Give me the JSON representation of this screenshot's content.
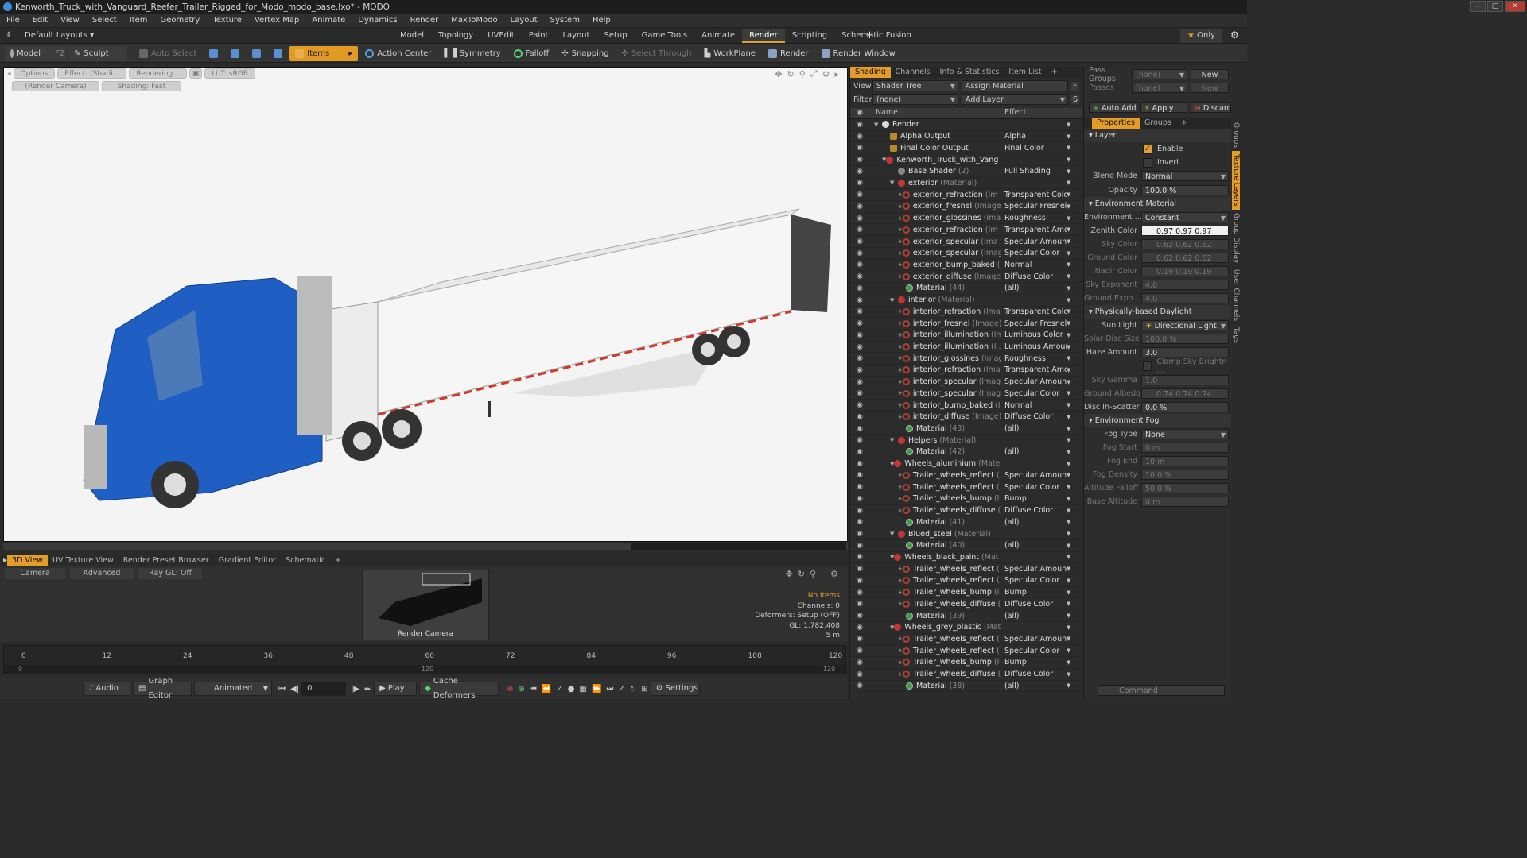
{
  "window": {
    "title": "Kenworth_Truck_with_Vanguard_Reefer_Trailer_Rigged_for_Modo_modo_base.lxo* - MODO"
  },
  "menu": [
    "File",
    "Edit",
    "View",
    "Select",
    "Item",
    "Geometry",
    "Texture",
    "Vertex Map",
    "Animate",
    "Dynamics",
    "Render",
    "MaxToModo",
    "Layout",
    "System",
    "Help"
  ],
  "layouts": {
    "selector": "Default Layouts",
    "tabs": [
      "Model",
      "Topology",
      "UVEdit",
      "Paint",
      "Layout",
      "Setup",
      "Game Tools",
      "Animate",
      "Render",
      "Scripting",
      "Schematic Fusion"
    ],
    "active": "Render",
    "only": "Only"
  },
  "toolbar": {
    "model": "Model",
    "model_key": "F2",
    "sculpt": "Sculpt",
    "auto_select": "Auto Select",
    "items": "Items",
    "action_center": "Action Center",
    "symmetry": "Symmetry",
    "falloff": "Falloff",
    "snapping": "Snapping",
    "select_through": "Select Through",
    "workplane": "WorkPlane",
    "render": "Render",
    "render_window": "Render Window"
  },
  "viewport": {
    "options": "Options",
    "effect": "Effect: (Shadi...",
    "rendering": "Rendering...",
    "lut": "LUT: sRGB",
    "camera": "(Render Camera)",
    "shading": "Shading: Fast",
    "colors": {
      "cab": "#1f5fc4",
      "trailer": "#f2f2f2",
      "rail": "#d03a2a"
    }
  },
  "bottom": {
    "tabs": [
      "3D View",
      "UV Texture View",
      "Render Preset Browser",
      "Gradient Editor",
      "Schematic"
    ],
    "active": "3D View",
    "camera": "Camera",
    "advanced": "Advanced",
    "raygl": "Ray GL: Off",
    "cam_label": "Render Camera",
    "stats": {
      "items": "No Items",
      "channels": "Channels: 0",
      "deformers": "Deformers: Setup (OFF)",
      "gl": "GL: 1,782,408",
      "dist": "5 m"
    }
  },
  "timeline": {
    "ticks": [
      "0",
      "12",
      "24",
      "36",
      "48",
      "60",
      "72",
      "84",
      "96",
      "108",
      "120"
    ],
    "subticks": [
      "0",
      "120",
      "120"
    ]
  },
  "transport": {
    "audio": "Audio",
    "graph_editor": "Graph Editor",
    "animated": "Animated",
    "frame": "0",
    "play": "Play",
    "cache": "Cache Deformers",
    "settings": "Settings"
  },
  "shading": {
    "tabs": [
      "Shading",
      "Channels",
      "Info & Statistics",
      "Item List"
    ],
    "active": "Shading",
    "view_label": "View",
    "view_value": "Shader Tree",
    "assign": "Assign Material",
    "filter_label": "Filter",
    "filter_value": "(none)",
    "add_layer": "Add Layer",
    "col_name": "Name",
    "col_effect": "Effect",
    "rows": [
      {
        "indent": 0,
        "exp": "▼",
        "icon": "ball",
        "name": "Render",
        "sub": "",
        "effect": ""
      },
      {
        "indent": 1,
        "exp": "",
        "icon": "out",
        "name": "Alpha Output",
        "sub": "",
        "effect": "Alpha"
      },
      {
        "indent": 1,
        "exp": "",
        "icon": "out",
        "name": "Final Color Output",
        "sub": "",
        "effect": "Final Color"
      },
      {
        "indent": 1,
        "exp": "▼",
        "icon": "mat",
        "name": "Kenworth_Truck_with_Vang ...",
        "sub": "",
        "effect": ""
      },
      {
        "indent": 2,
        "exp": "",
        "icon": "shd",
        "name": "Base Shader",
        "sub": "(2)",
        "effect": "Full Shading"
      },
      {
        "indent": 2,
        "exp": "▼",
        "icon": "mat",
        "name": "exterior",
        "sub": "(Material)",
        "effect": ""
      },
      {
        "indent": 3,
        "exp": "+",
        "icon": "img",
        "name": "exterior_refraction",
        "sub": "(Im ...",
        "effect": "Transparent Color"
      },
      {
        "indent": 3,
        "exp": "+",
        "icon": "img",
        "name": "exterior_fresnel",
        "sub": "(Image)",
        "effect": "Specular Fresnel"
      },
      {
        "indent": 3,
        "exp": "+",
        "icon": "img",
        "name": "exterior_glossines",
        "sub": "(Ima ...",
        "effect": "Roughness"
      },
      {
        "indent": 3,
        "exp": "+",
        "icon": "img",
        "name": "exterior_refraction",
        "sub": "(Im ...",
        "effect": "Transparent Amo ..."
      },
      {
        "indent": 3,
        "exp": "+",
        "icon": "img",
        "name": "exterior_specular",
        "sub": "(Ima ...",
        "effect": "Specular Amount"
      },
      {
        "indent": 3,
        "exp": "+",
        "icon": "img",
        "name": "exterior_specular",
        "sub": "(Image)",
        "effect": "Specular Color"
      },
      {
        "indent": 3,
        "exp": "+",
        "icon": "img",
        "name": "exterior_bump_baked",
        "sub": "(I ...",
        "effect": "Normal"
      },
      {
        "indent": 3,
        "exp": "+",
        "icon": "img",
        "name": "exterior_diffuse",
        "sub": "(Image)",
        "effect": "Diffuse Color"
      },
      {
        "indent": 3,
        "exp": "",
        "icon": "mt",
        "name": "Material",
        "sub": "(44)",
        "effect": "(all)"
      },
      {
        "indent": 2,
        "exp": "▼",
        "icon": "mat",
        "name": "interior",
        "sub": "(Material)",
        "effect": ""
      },
      {
        "indent": 3,
        "exp": "+",
        "icon": "img",
        "name": "interior_refraction",
        "sub": "(Ima ...",
        "effect": "Transparent Color"
      },
      {
        "indent": 3,
        "exp": "+",
        "icon": "img",
        "name": "interior_fresnel",
        "sub": "(Image)",
        "effect": "Specular Fresnel"
      },
      {
        "indent": 3,
        "exp": "+",
        "icon": "img",
        "name": "interior_illumination",
        "sub": "(Im ...",
        "effect": "Luminous Color"
      },
      {
        "indent": 3,
        "exp": "+",
        "icon": "img",
        "name": "interior_illumination",
        "sub": "(I ...",
        "effect": "Luminous Amount"
      },
      {
        "indent": 3,
        "exp": "+",
        "icon": "img",
        "name": "interior_glossines",
        "sub": "(Image)",
        "effect": "Roughness"
      },
      {
        "indent": 3,
        "exp": "+",
        "icon": "img",
        "name": "interior_refraction",
        "sub": "(Ima ...",
        "effect": "Transparent Amo ..."
      },
      {
        "indent": 3,
        "exp": "+",
        "icon": "img",
        "name": "interior_specular",
        "sub": "(Imag ...",
        "effect": "Specular Amount"
      },
      {
        "indent": 3,
        "exp": "+",
        "icon": "img",
        "name": "interior_specular",
        "sub": "(Image)",
        "effect": "Specular Color"
      },
      {
        "indent": 3,
        "exp": "+",
        "icon": "img",
        "name": "interior_bump_baked",
        "sub": "(I ...",
        "effect": "Normal"
      },
      {
        "indent": 3,
        "exp": "+",
        "icon": "img",
        "name": "interior_diffuse",
        "sub": "(Image)",
        "effect": "Diffuse Color"
      },
      {
        "indent": 3,
        "exp": "",
        "icon": "mt",
        "name": "Material",
        "sub": "(43)",
        "effect": "(all)"
      },
      {
        "indent": 2,
        "exp": "▼",
        "icon": "mat",
        "name": "Helpers",
        "sub": "(Material)",
        "effect": ""
      },
      {
        "indent": 3,
        "exp": "",
        "icon": "mt",
        "name": "Material",
        "sub": "(42)",
        "effect": "(all)"
      },
      {
        "indent": 2,
        "exp": "▼",
        "icon": "mat",
        "name": "Wheels_aluminium",
        "sub": "(Material)",
        "effect": ""
      },
      {
        "indent": 3,
        "exp": "+",
        "icon": "img",
        "name": "Trailer_wheels_reflect",
        "sub": "( ...",
        "effect": "Specular Amount"
      },
      {
        "indent": 3,
        "exp": "+",
        "icon": "img",
        "name": "Trailer_wheels_reflect",
        "sub": "( ...",
        "effect": "Specular Color"
      },
      {
        "indent": 3,
        "exp": "+",
        "icon": "img",
        "name": "Trailer_wheels_bump",
        "sub": "(I ...",
        "effect": "Bump"
      },
      {
        "indent": 3,
        "exp": "+",
        "icon": "img",
        "name": "Trailer_wheels_diffuse",
        "sub": "( ...",
        "effect": "Diffuse Color"
      },
      {
        "indent": 3,
        "exp": "",
        "icon": "mt",
        "name": "Material",
        "sub": "(41)",
        "effect": "(all)"
      },
      {
        "indent": 2,
        "exp": "▼",
        "icon": "mat",
        "name": "Blued_steel",
        "sub": "(Material)",
        "effect": ""
      },
      {
        "indent": 3,
        "exp": "",
        "icon": "mt",
        "name": "Material",
        "sub": "(40)",
        "effect": "(all)"
      },
      {
        "indent": 2,
        "exp": "▼",
        "icon": "mat",
        "name": "Wheels_black_paint",
        "sub": "(Mat ...",
        "effect": ""
      },
      {
        "indent": 3,
        "exp": "+",
        "icon": "img",
        "name": "Trailer_wheels_reflect",
        "sub": "( ...",
        "effect": "Specular Amount"
      },
      {
        "indent": 3,
        "exp": "+",
        "icon": "img",
        "name": "Trailer_wheels_reflect",
        "sub": "( ...",
        "effect": "Specular Color"
      },
      {
        "indent": 3,
        "exp": "+",
        "icon": "img",
        "name": "Trailer_wheels_bump",
        "sub": "(I ...",
        "effect": "Bump"
      },
      {
        "indent": 3,
        "exp": "+",
        "icon": "img",
        "name": "Trailer_wheels_diffuse",
        "sub": "( ...",
        "effect": "Diffuse Color"
      },
      {
        "indent": 3,
        "exp": "",
        "icon": "mt",
        "name": "Material",
        "sub": "(39)",
        "effect": "(all)"
      },
      {
        "indent": 2,
        "exp": "▼",
        "icon": "mat",
        "name": "Wheels_grey_plastic",
        "sub": "(Mat ...",
        "effect": ""
      },
      {
        "indent": 3,
        "exp": "+",
        "icon": "img",
        "name": "Trailer_wheels_reflect",
        "sub": "( ...",
        "effect": "Specular Amount"
      },
      {
        "indent": 3,
        "exp": "+",
        "icon": "img",
        "name": "Trailer_wheels_reflect",
        "sub": "( ...",
        "effect": "Specular Color"
      },
      {
        "indent": 3,
        "exp": "+",
        "icon": "img",
        "name": "Trailer_wheels_bump",
        "sub": "(I ...",
        "effect": "Bump"
      },
      {
        "indent": 3,
        "exp": "+",
        "icon": "img",
        "name": "Trailer_wheels_diffuse",
        "sub": "( ...",
        "effect": "Diffuse Color"
      },
      {
        "indent": 3,
        "exp": "",
        "icon": "mt",
        "name": "Material",
        "sub": "(38)",
        "effect": "(all)"
      }
    ]
  },
  "props": {
    "pass_groups": "Pass Groups",
    "passes": "Passes",
    "none": "(none)",
    "new": "New",
    "auto_add": "Auto Add",
    "apply": "Apply",
    "discard": "Discard",
    "tab_properties": "Properties",
    "tab_groups": "Groups",
    "layer": "Layer",
    "enable": "Enable",
    "invert": "Invert",
    "blend_mode": "Blend Mode",
    "blend_value": "Normal",
    "opacity": "Opacity",
    "opacity_value": "100.0 %",
    "env_material": "Environment Material",
    "environment": "Environment ...",
    "environment_value": "Constant",
    "zenith": "Zenith Color",
    "zenith_value": "0.97   0.97   0.97",
    "sky": "Sky Color",
    "sky_value": "0.62   0.62   0.62",
    "ground": "Ground Color",
    "ground_value": "0.62   0.62   0.62",
    "nadir": "Nadir Color",
    "nadir_value": "0.19   0.19   0.19",
    "sky_exp": "Sky Exponent",
    "sky_exp_value": "4.0",
    "ground_exp": "Ground Expo ...",
    "ground_exp_value": "4.0",
    "daylight": "Physically-based Daylight",
    "sun": "Sun Light",
    "sun_value": "Directional Light",
    "disc": "Solar Disc Size",
    "disc_value": "100.0 %",
    "haze": "Haze Amount",
    "haze_value": "3.0",
    "clamp": "Clamp Sky Brightn ...",
    "gamma": "Sky Gamma",
    "gamma_value": "1.0",
    "albedo": "Ground Albedo",
    "albedo_value": "0.74   0.74   0.74",
    "disc_scatter": "Disc In-Scatter",
    "disc_scatter_value": "0.0 %",
    "fog": "Environment Fog",
    "fog_type": "Fog Type",
    "fog_type_value": "None",
    "fog_start": "Fog Start",
    "fog_start_value": "0 m",
    "fog_end": "Fog End",
    "fog_end_value": "10 m",
    "fog_density": "Fog Density",
    "fog_density_value": "10.0 %",
    "alt_falloff": "Altitude Falloff",
    "alt_falloff_value": "50.0 %",
    "base_alt": "Base Altitude",
    "base_alt_value": "0 m",
    "vtabs": [
      "Groups",
      "Texture Layers",
      "Group Display",
      "User Channels",
      "Tags"
    ],
    "command": "Command"
  }
}
